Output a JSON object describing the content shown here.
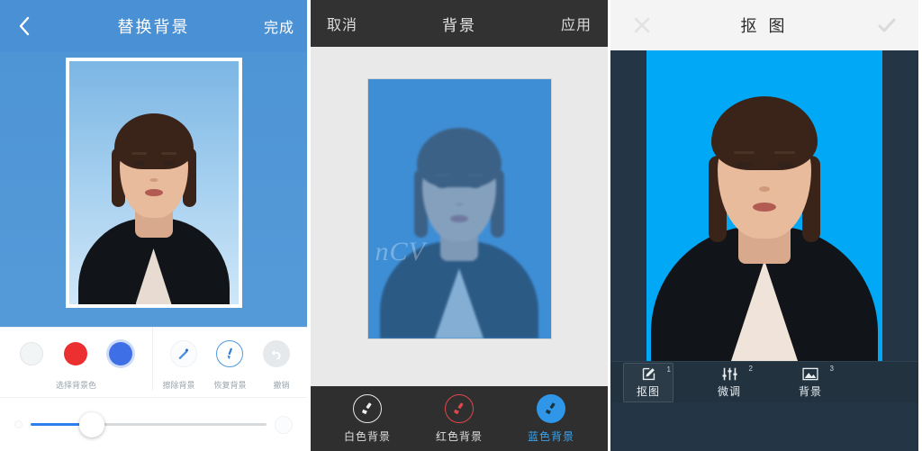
{
  "panel1": {
    "header": {
      "back_icon": "chevron-left-icon",
      "title": "替换背景",
      "done_label": "完成"
    },
    "colors": {
      "label": "选择背景色",
      "swatches": [
        {
          "name": "white",
          "hex": "#F2F5F6",
          "selected": false
        },
        {
          "name": "red",
          "hex": "#EC2F31",
          "selected": false
        },
        {
          "name": "blue",
          "hex": "#3F6FE6",
          "selected": true
        }
      ]
    },
    "brushes": [
      {
        "icon": "eraser-brush-icon",
        "label": "擦除背景",
        "state": "normal"
      },
      {
        "icon": "restore-brush-icon",
        "label": "恢复背景",
        "state": "active"
      },
      {
        "icon": "undo-arrow-icon",
        "label": "撤销",
        "state": "disabled"
      }
    ],
    "slider": {
      "name": "brush-size-slider",
      "value_percent": 26,
      "min_icon": "small-dot-icon",
      "max_icon": "large-dot-icon"
    },
    "photo": {
      "background_hex": "#4A90D4",
      "frame_border_hex": "#FFFFFF"
    }
  },
  "panel2": {
    "header": {
      "cancel_label": "取消",
      "title": "背景",
      "apply_label": "应用"
    },
    "photo": {
      "background_hex": "#3E8ED6",
      "watermark": "nCV"
    },
    "background_options": [
      {
        "icon": "brush-icon",
        "label": "白色背景",
        "state": "normal",
        "accent_hex": "#E8E8E8"
      },
      {
        "icon": "brush-icon",
        "label": "红色背景",
        "state": "normal",
        "accent_hex": "#E0474B"
      },
      {
        "icon": "brush-icon",
        "label": "蓝色背景",
        "state": "selected",
        "accent_hex": "#2F96E8"
      }
    ]
  },
  "panel3": {
    "header": {
      "close_icon": "close-x-icon",
      "title": "抠 图",
      "confirm_icon": "check-icon"
    },
    "photo": {
      "background_hex": "#00A8F5",
      "surround_hex": "#243646"
    },
    "tabs": [
      {
        "num": "1",
        "icon": "cutout-icon",
        "label": "抠图",
        "active": true
      },
      {
        "num": "2",
        "icon": "sliders-icon",
        "label": "微调",
        "active": false
      },
      {
        "num": "3",
        "icon": "image-icon",
        "label": "背景",
        "active": false
      }
    ]
  }
}
